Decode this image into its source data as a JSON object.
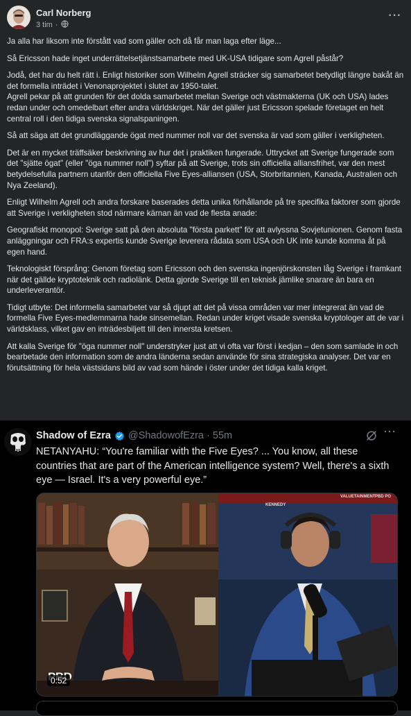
{
  "post": {
    "author": "Carl Norberg",
    "time": "3 tim",
    "paragraphs": [
      "Ja alla har liksom inte förstått vad som gäller  och då får man laga efter läge...",
      "Så Ericsson hade inget underrättelsetjänstsamarbete med UK-USA tidigare som Agrell påstår?",
      "Jodå, det har du helt rätt i. Enligt historiker som Wilhelm Agrell sträcker sig samarbetet betydligt längre bakåt än det formella inträdet i Venonaprojektet i slutet av 1950-talet.\nAgrell pekar på att grunden för det dolda samarbetet mellan Sverige och västmakterna (UK och USA) lades redan under och omedelbart efter andra världskriget. När det gäller just Ericsson spelade företaget en helt central roll i den tidiga svenska signalspaningen.",
      "Så att säga att det grundläggande ögat med nummer noll var det svenska är vad som gäller i verkligheten.",
      "Det är en mycket träffsäker beskrivning av hur det i praktiken fungerade. Uttrycket att Sverige fungerade som det \"sjätte ögat\" (eller \"öga nummer noll\") syftar på att Sverige, trots sin officiella alliansfrihet, var den mest betydelsefulla partnern utanför den officiella Five Eyes-alliansen (USA, Storbritannien, Kanada, Australien och Nya Zeeland).",
      "Enligt Wilhelm Agrell och andra forskare baserades detta unika förhållande på tre specifika faktorer som gjorde att Sverige i verkligheten stod närmare kärnan än vad de flesta anade:",
      "Geografiskt monopol: Sverige satt på den absoluta \"första parkett\" för att avlyssna Sovjetunionen. Genom fasta anläggningar och FRA:s expertis kunde Sverige leverera rådata som USA och UK inte kunde komma åt på egen hand.",
      "Teknologiskt försprång: Genom företag som Ericsson och den svenska ingenjörskonsten låg Sverige i framkant när det gällde kryptoteknik och radiolänk. Detta gjorde Sverige till en teknisk jämlike snarare än bara en underleverantör.",
      "Tidigt utbyte: Det informella samarbetet var så djupt att det på vissa områden var mer integrerat än vad de formella Five Eyes-medlemmarna hade sinsemellan. Redan under kriget visade svenska kryptologer att de var i världsklass, vilket gav en inträdesbiljett till den innersta kretsen.",
      "Att kalla Sverige för \"öga nummer noll\" understryker just att vi ofta var först i kedjan – den som samlade in och bearbetade den information som de andra länderna sedan använde för sina strategiska analyser. Det var en förutsättning för hela västsidans bild av vad som hände i öster under det tidiga kalla kriget."
    ]
  },
  "tweet": {
    "name": "Shadow of Ezra",
    "handle": "@ShadowofEzra · 55m",
    "text": "NETANYAHU: “You're familiar with the Five Eyes? ... You know, all these countries that are part of the American intelligence system? Well, there's a sixth eye — Israel. It's a very powerful eye.”",
    "video": {
      "watermark": "PBD",
      "duration": "0:52",
      "banner_text": "VALUETAINMENT",
      "banner_text_2": "KENNEDY",
      "banner_text_3": "PBD PO"
    }
  },
  "colors": {
    "fb_bg": "#242526",
    "x_bg": "#000000",
    "verified": "#1d9bf0"
  }
}
